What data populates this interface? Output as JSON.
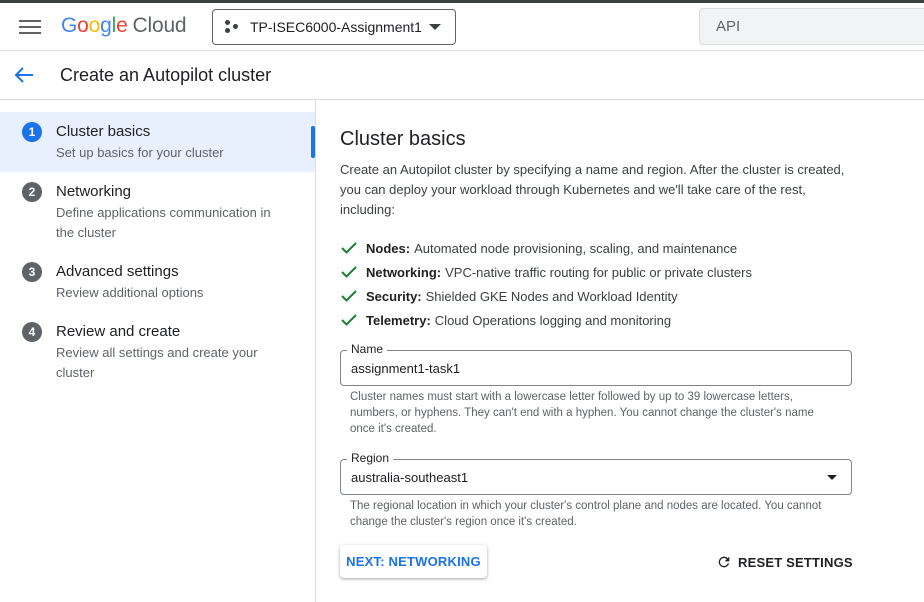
{
  "topbar": {
    "logo": {
      "google": "Google",
      "cloud": "Cloud"
    },
    "project": "TP-ISEC6000-Assignment1",
    "search_text": "API"
  },
  "header": {
    "title": "Create an Autopilot cluster"
  },
  "steps": [
    {
      "num": "1",
      "title": "Cluster basics",
      "desc": "Set up basics for your cluster"
    },
    {
      "num": "2",
      "title": "Networking",
      "desc": "Define applications communication in the cluster"
    },
    {
      "num": "3",
      "title": "Advanced settings",
      "desc": "Review additional options"
    },
    {
      "num": "4",
      "title": "Review and create",
      "desc": "Review all settings and create your cluster"
    }
  ],
  "main": {
    "heading": "Cluster basics",
    "intro": "Create an Autopilot cluster by specifying a name and region. After the cluster is created, you can deploy your workload through Kubernetes and we'll take care of the rest, including:",
    "features": [
      {
        "label": "Nodes:",
        "text": "Automated node provisioning, scaling, and maintenance"
      },
      {
        "label": "Networking:",
        "text": "VPC-native traffic routing for public or private clusters"
      },
      {
        "label": "Security:",
        "text": "Shielded GKE Nodes and Workload Identity"
      },
      {
        "label": "Telemetry:",
        "text": "Cloud Operations logging and monitoring"
      }
    ],
    "name_field": {
      "label": "Name",
      "value": "assignment1-task1",
      "help": "Cluster names must start with a lowercase letter followed by up to 39 lowercase letters, numbers, or hyphens. They can't end with a hyphen. You cannot change the cluster's name once it's created."
    },
    "region_field": {
      "label": "Region",
      "value": "australia-southeast1",
      "help": "The regional location in which your cluster's control plane and nodes are located. You cannot change the cluster's region once it's created."
    },
    "next_button": "NEXT: NETWORKING",
    "reset_button": "RESET SETTINGS"
  },
  "colors": {
    "accent": "#1a73e8",
    "check": "#188038",
    "step_inactive": "#5f6368"
  }
}
